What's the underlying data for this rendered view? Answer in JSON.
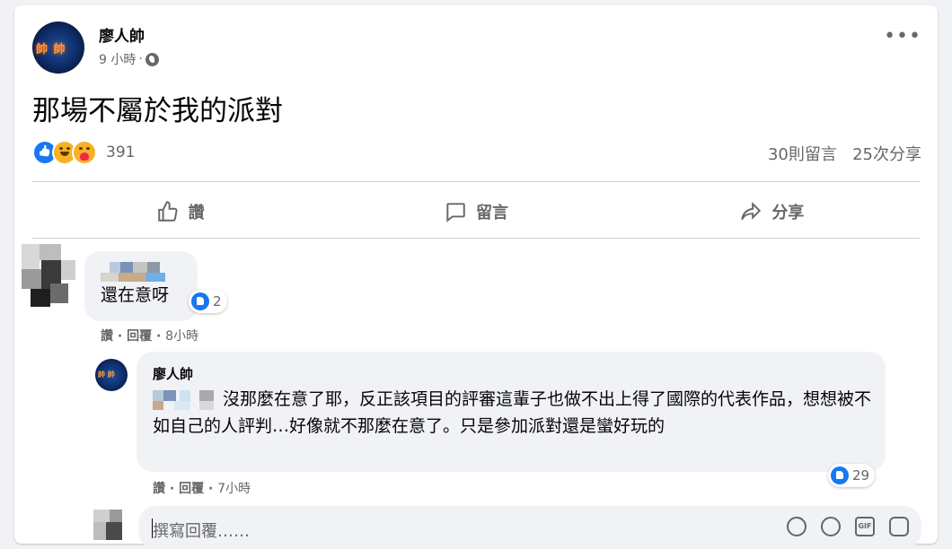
{
  "post": {
    "author": "廖人帥",
    "time": "9 小時",
    "dot": "·",
    "text": "那場不屬於我的派對",
    "reaction_count": "391",
    "comments_count": "30則留言",
    "shares_count": "25次分享"
  },
  "actions": {
    "like": "讚",
    "comment": "留言",
    "share": "分享"
  },
  "comment1": {
    "text": "還在意呀",
    "likes": "2",
    "like_label": "讚",
    "reply_label": "回覆",
    "time": "8小時"
  },
  "reply1": {
    "author": "廖人帥",
    "text": "沒那麼在意了耶，反正該項目的評審這輩子也做不出上得了國際的代表作品，想想被不如自己的人評判…好像就不那麼在意了。只是參加派對還是蠻好玩的",
    "likes": "29",
    "like_label": "讚",
    "reply_label": "回覆",
    "time": "7小時"
  },
  "composer": {
    "placeholder": "撰寫回覆……"
  },
  "colors": {
    "accent": "#1877f2",
    "secondary_text": "#65676b",
    "bubble": "#f0f2f5"
  },
  "icons": [
    "globe-icon",
    "more-icon",
    "like-icon",
    "comment-icon",
    "share-icon",
    "emoji-icon",
    "camera-icon",
    "gif-icon",
    "sticker-icon"
  ]
}
